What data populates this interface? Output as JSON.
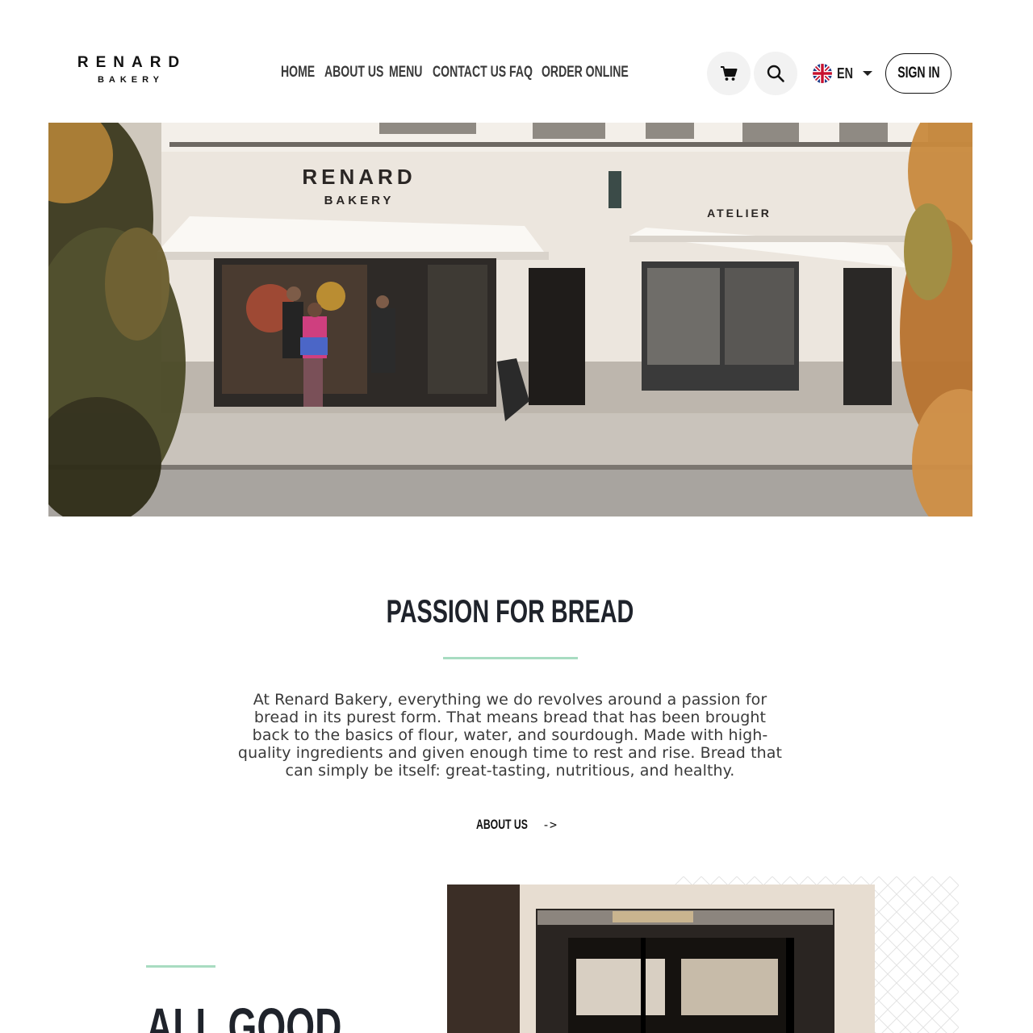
{
  "brand": {
    "name": "RENARD",
    "subtitle": "BAKERY"
  },
  "nav": {
    "items": [
      {
        "label": "HOME"
      },
      {
        "label": "ABOUT US"
      },
      {
        "label": "MENU"
      },
      {
        "label": "CONTACT US"
      },
      {
        "label": "FAQ"
      },
      {
        "label": "ORDER ONLINE"
      }
    ]
  },
  "header": {
    "cart_icon": "cart-icon",
    "search_icon": "search-icon",
    "language": {
      "code": "EN",
      "flag_icon": "uk-flag-icon"
    },
    "signin_label": "SIGN IN"
  },
  "hero": {
    "storefront_sign_main": "RENARD",
    "storefront_sign_sub": "BAKERY",
    "storefront_sign_side": "ATELIER"
  },
  "passion": {
    "title": "PASSION FOR BREAD",
    "body": "At Renard Bakery, everything we do revolves around a passion for bread in its purest form. That means bread that has been brought back to the basics of flour, water, and sourdough. Made with high-quality ingredients and given enough time to rest and rise. Bread that can simply be itself: great-tasting, nutritious, and healthy.",
    "link_label": "ABOUT US",
    "link_arrow": "->"
  },
  "lower": {
    "heading": "ALL GOOD"
  },
  "colors": {
    "accent": "#a8dcc1",
    "text_dark": "#1f232b",
    "icon_bg": "#f2f2f2"
  }
}
